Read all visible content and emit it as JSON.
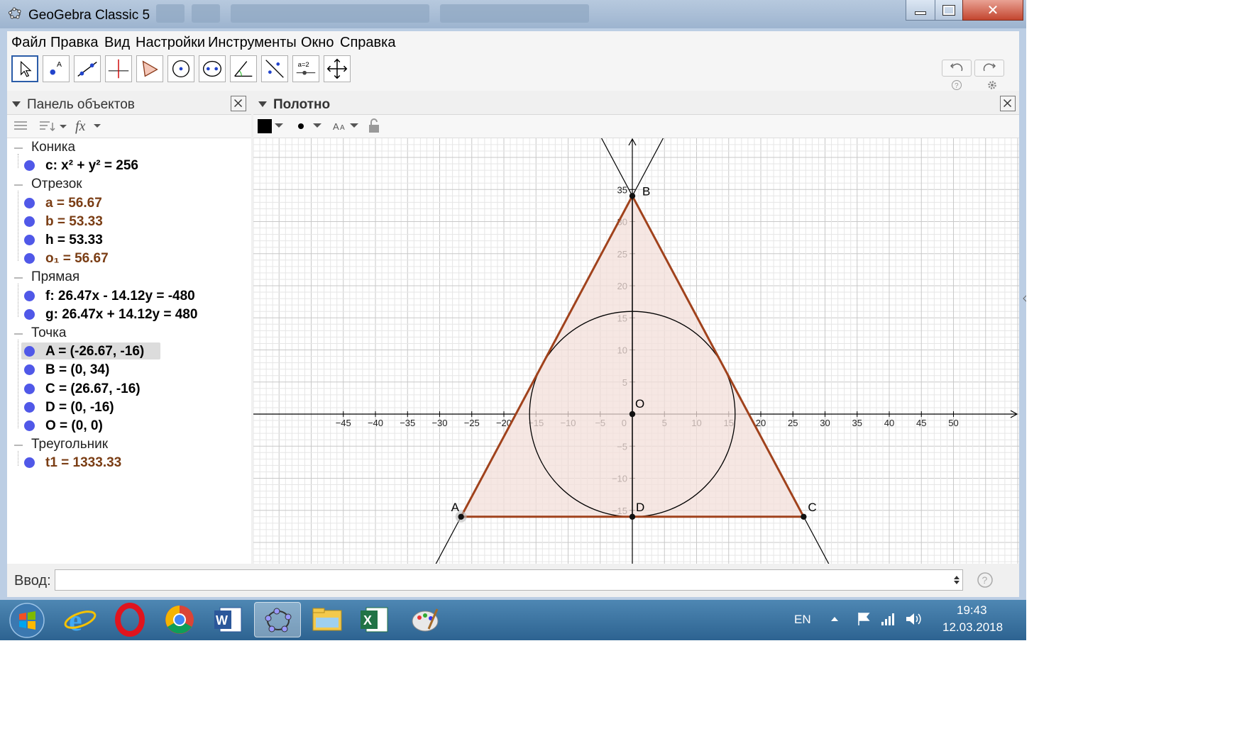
{
  "window": {
    "title": "GeoGebra Classic 5",
    "minimize_label": "—",
    "maximize_label": "☐",
    "close_label": "✕"
  },
  "menu": [
    "Файл",
    "Правка",
    "Вид",
    "Настройки",
    "Инструменты",
    "Окно",
    "Справка"
  ],
  "toolbar": {
    "tools": [
      "move-tool",
      "point-tool",
      "line-tool",
      "perpendicular-tool",
      "polygon-tool",
      "circle-tool",
      "ellipse-tool",
      "angle-tool",
      "reflect-tool",
      "slider-tool",
      "move-view-tool"
    ],
    "slider_tool_label": "a=2",
    "undo_icon": "undo-icon",
    "redo_icon": "redo-icon",
    "help_icon": "help-icon",
    "settings_icon": "gear-icon"
  },
  "algebra": {
    "title": "Панель объектов",
    "categories": [
      {
        "name": "Коника",
        "items": [
          {
            "label": "c: x² + y² = 256",
            "color": "#000000"
          }
        ]
      },
      {
        "name": "Отрезок",
        "items": [
          {
            "label": "a = 56.67",
            "color": "#7a3d14"
          },
          {
            "label": "b = 53.33",
            "color": "#7a3d14"
          },
          {
            "label": "h = 53.33",
            "color": "#000000"
          },
          {
            "label": "o₁ = 56.67",
            "color": "#7a3d14"
          }
        ]
      },
      {
        "name": "Прямая",
        "items": [
          {
            "label": "f: 26.47x - 14.12y = -480",
            "color": "#000000"
          },
          {
            "label": "g: 26.47x + 14.12y = 480",
            "color": "#000000"
          }
        ]
      },
      {
        "name": "Точка",
        "items": [
          {
            "label": "A = (-26.67, -16)",
            "color": "#000000",
            "selected": true
          },
          {
            "label": "B = (0, 34)",
            "color": "#000000"
          },
          {
            "label": "C = (26.67, -16)",
            "color": "#000000"
          },
          {
            "label": "D = (0, -16)",
            "color": "#000000"
          },
          {
            "label": "O = (0, 0)",
            "color": "#000000"
          }
        ]
      },
      {
        "name": "Треугольник",
        "items": [
          {
            "label": "t1 = 1333.33",
            "color": "#7a3d14"
          }
        ]
      }
    ]
  },
  "graphics": {
    "title": "Полотно",
    "x_ticks": [
      -45,
      -40,
      -35,
      -30,
      -25,
      -20,
      -15,
      -10,
      -5,
      5,
      10,
      15,
      20,
      25,
      30,
      35,
      40,
      45,
      50
    ],
    "y_ticks": [
      35,
      30,
      25,
      20,
      15,
      10,
      5,
      -5,
      -10,
      -15
    ],
    "origin_label": "0",
    "points": [
      {
        "name": "A",
        "x": -26.67,
        "y": -16
      },
      {
        "name": "B",
        "x": 0,
        "y": 34
      },
      {
        "name": "C",
        "x": 26.67,
        "y": -16
      },
      {
        "name": "D",
        "x": 0,
        "y": -16
      },
      {
        "name": "O",
        "x": 0,
        "y": 0
      }
    ],
    "circle": {
      "cx": 0,
      "cy": 0,
      "r": 16
    },
    "triangle_color": "#a0421c",
    "fill_color": "#f3dfd9"
  },
  "input": {
    "label": "Ввод:",
    "value": ""
  },
  "taskbar": {
    "apps": [
      "windows-start-icon",
      "internet-explorer-icon",
      "opera-icon",
      "chrome-icon",
      "word-icon",
      "geogebra-icon",
      "explorer-icon",
      "excel-icon",
      "paint-icon"
    ],
    "language": "EN",
    "time": "19:43",
    "date": "12.03.2018"
  }
}
